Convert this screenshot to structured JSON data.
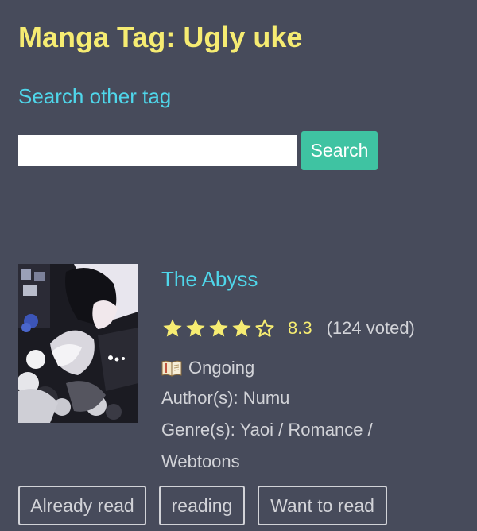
{
  "header": {
    "title": "Manga Tag: Ugly uke",
    "search_link": "Search other tag"
  },
  "search": {
    "value": "",
    "placeholder": "",
    "button_label": "Search"
  },
  "manga": {
    "title": "The Abyss",
    "rating": {
      "stars_filled": 4,
      "stars_total": 5,
      "value": "8.3",
      "votes": "(124 voted)"
    },
    "status": "Ongoing",
    "status_icon": "book-icon",
    "author": "Author(s): Numu",
    "genres_line1": "Genre(s): Yaoi / Romance /",
    "genres_line2": "Webtoons"
  },
  "list_buttons": {
    "already_read": "Already read",
    "reading": "reading",
    "want_to_read": "Want to read"
  },
  "colors": {
    "background": "#474b5b",
    "title": "#f6ec72",
    "link": "#4fd6ea",
    "search_button": "#3fc3a2",
    "star": "#f6ec72"
  }
}
